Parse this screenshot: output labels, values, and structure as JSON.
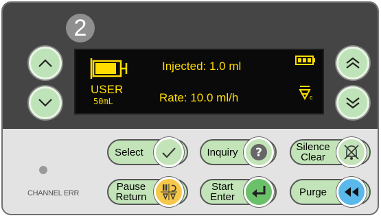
{
  "channel": {
    "number": "2"
  },
  "lcd": {
    "mode": "USER",
    "syringe_volume": "50mL",
    "injected": "Injected: 1.0 ml",
    "rate": "Rate: 10.0 ml/h",
    "occlusion_suffix": "c"
  },
  "colors": {
    "lcd_text": "#ffdd00",
    "button_green": "#c2e4b8",
    "purge_blue": "#5bb8ea",
    "pause_yellow": "#f6c84a",
    "start_green": "#6bc06a"
  },
  "buttons": {
    "select": "Select",
    "inquiry": "Inquiry",
    "silence_line1": "Silence",
    "silence_line2": "Clear",
    "pause_line1": "Pause",
    "pause_line2": "Return",
    "start_line1": "Start",
    "start_line2": "Enter",
    "purge": "Purge"
  },
  "status": {
    "channel_err": "CHANNEL ERR"
  },
  "icons": [
    "chevron-up-icon",
    "chevron-down-icon",
    "double-chevron-up-icon",
    "double-chevron-down-icon",
    "syringe-icon",
    "battery-icon",
    "occlusion-icon",
    "checkmark-icon",
    "question-icon",
    "alarm-silence-icon",
    "pause-return-icon",
    "enter-icon",
    "rewind-icon"
  ]
}
